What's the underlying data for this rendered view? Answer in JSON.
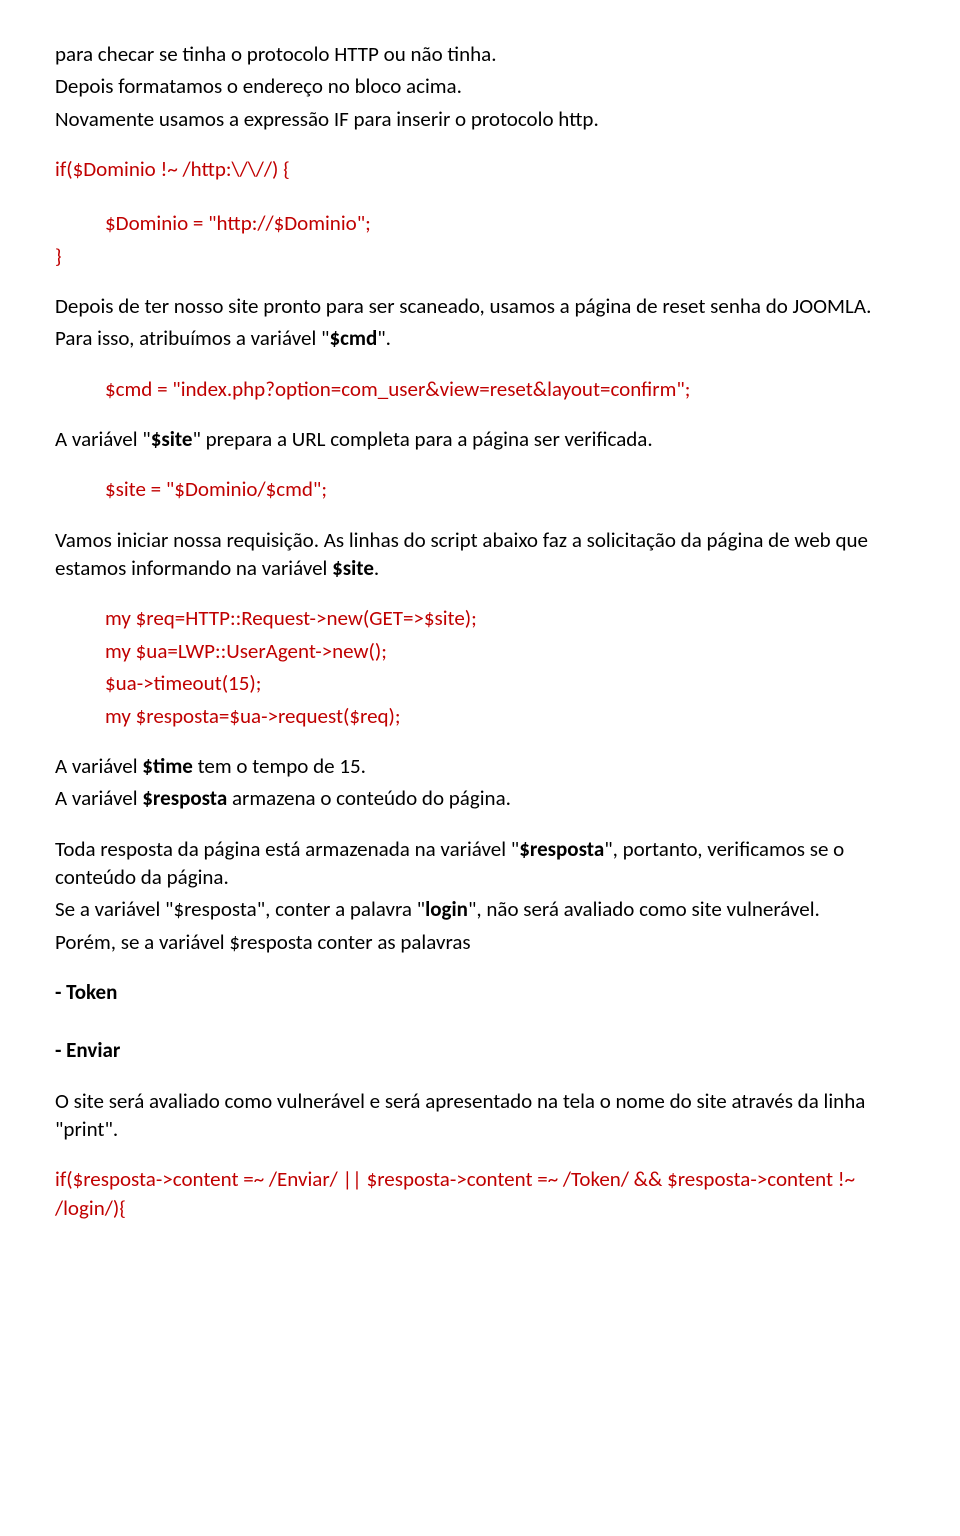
{
  "p1a": "para checar se tinha o protocolo HTTP ou não tinha.",
  "p1b": "Depois formatamos o endereço no bloco acima.",
  "p1c": "Novamente usamos a expressão IF para inserir o protocolo http.",
  "code1a": "if($Dominio !~ /http:\\/\\//) {",
  "code1b": "$Dominio = \"http://$Dominio\";",
  "code1c": "}",
  "p2a": "Depois de ter nosso site pronto para ser scaneado, usamos a página de reset senha do JOOMLA.",
  "p2b_pre": "Para isso, atribuímos a variável \"",
  "p2b_bold": "$cmd",
  "p2b_post": "\".",
  "code2": "$cmd = \"index.php?option=com_user&view=reset&layout=confirm\";",
  "p3_pre": "A variável \"",
  "p3_bold": "$site",
  "p3_post": "\" prepara a URL completa para a página ser verificada.",
  "code3": "$site = \"$Dominio/$cmd\";",
  "p4a": "Vamos iniciar nossa requisição. As linhas do script abaixo faz a solicitação da página de web que estamos informando na variável ",
  "p4a_bold": "$site",
  "p4a_end": ".",
  "code4a": "my $req=HTTP::Request->new(GET=>$site);",
  "code4b": "my $ua=LWP::UserAgent->new();",
  "code4c": "$ua->timeout(15);",
  "code4d": "my $resposta=$ua->request($req);",
  "p5a_pre": "A variável ",
  "p5a_bold": "$time",
  "p5a_post": " tem o tempo de 15.",
  "p5b_pre": "A variável ",
  "p5b_bold": "$resposta",
  "p5b_post": " armazena o conteúdo do página.",
  "p6a_pre": "Toda resposta da página está armazenada na variável \"",
  "p6a_bold": "$resposta",
  "p6a_post": "\",  portanto, verificamos se o conteúdo da página.",
  "p6b_pre": "Se a variável \"$resposta\", conter a palavra \"",
  "p6b_bold": "login",
  "p6b_post": "\", não será avaliado como site vulnerável.",
  "p6c": "Porém, se a variável $resposta conter as palavras",
  "token": " - Token",
  "enviar": " - Enviar",
  "p7": "O site será avaliado como vulnerável e será apresentado na tela o nome do site através da linha \"print\".",
  "code5": "if($resposta->content =~ /Enviar/ || $resposta->content =~ /Token/ && $resposta->content !~ /login/){"
}
